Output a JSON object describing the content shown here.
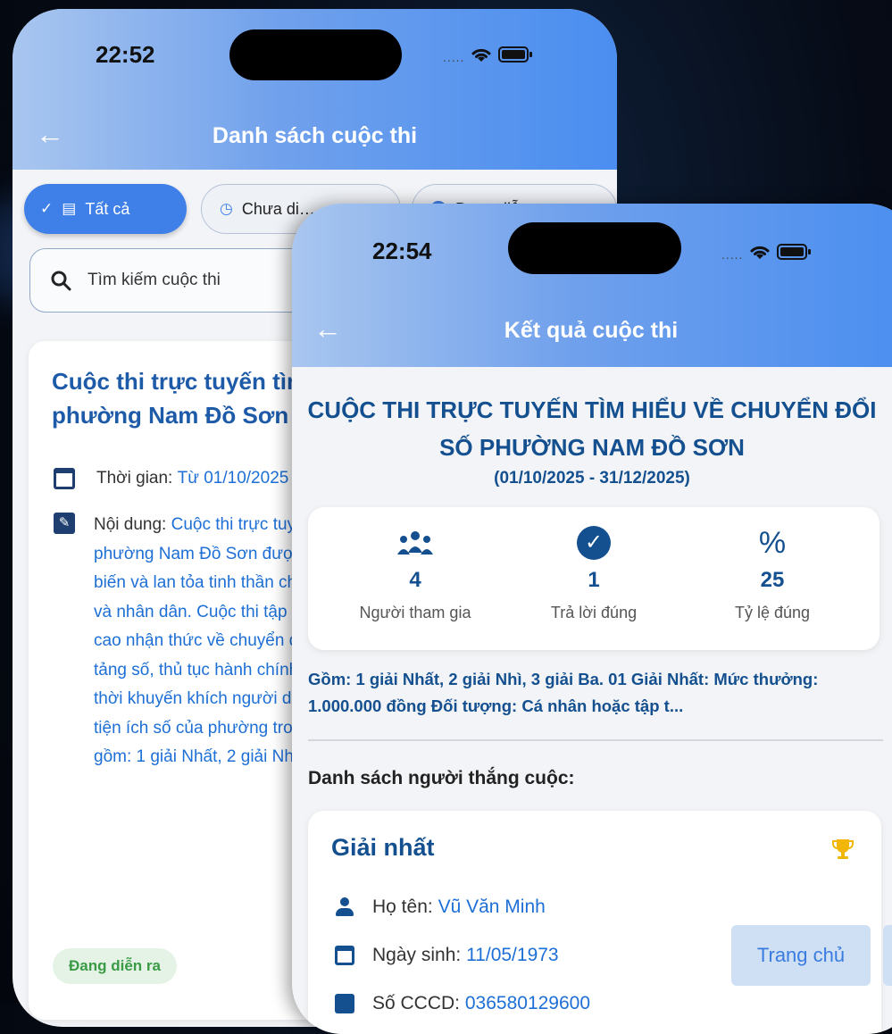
{
  "screen_a": {
    "status": {
      "time": "22:52",
      "dots": "....."
    },
    "header": {
      "title": "Danh sách cuộc thi"
    },
    "filters": [
      {
        "label": "Tất cả",
        "selected": true
      },
      {
        "label": "Chưa di…",
        "selected": false
      },
      {
        "label": "Đang diễ…",
        "selected": false
      }
    ],
    "search": {
      "placeholder": "Tìm kiếm cuộc thi"
    },
    "card": {
      "title": "Cuộc thi trực tuyến tìm hiểu về Chuyển đổi số phường Nam Đồ Sơn",
      "time_label": "Thời gian:",
      "time_value": "Từ 01/10/2025 đến 31/12/2025",
      "content_label": "Nội dung:",
      "content_value": "Cuộc thi trực tuyến tìm hiểu về Chuyển đổi số phường Nam Đồ Sơn được tổ chức nhằm tuyên truyền, phổ biến và lan tỏa tinh thần chuyển đổi số đến cán bộ, đảng viên và nhân dân. Cuộc thi tập trung vào các nội dung như: nâng cao nhận thức về chuyển đổi số, kỹ năng sử dụng các nền tảng số, thủ tục hành chính, dịch vụ công trực tuyến; đồng thời khuyến khích người dân chủ động tiếp cận, sử dụng các tiện ích số của phường trong đời sống thực tiễn. Giải thưởng gồm: 1 giải Nhất, 2 giải Nhì, 3 giải Ba.",
      "status_badge": "Đang diễn ra"
    }
  },
  "screen_b": {
    "status": {
      "time": "22:54",
      "dots": "....."
    },
    "header": {
      "title": "Kết quả cuộc thi"
    },
    "contest_title": "CUỘC THI TRỰC TUYẾN TÌM HIỂU VỀ CHUYỂN ĐỔI SỐ PHƯỜNG NAM ĐỒ SƠN",
    "period": "(01/10/2025 - 31/12/2025)",
    "stats": [
      {
        "icon": "people-icon",
        "value": "4",
        "label": "Người tham gia"
      },
      {
        "icon": "check-circle-icon",
        "value": "1",
        "label": "Trả lời đúng"
      },
      {
        "icon": "percent-icon",
        "value": "25",
        "label": "Tỷ lệ đúng"
      }
    ],
    "description": "Gồm: 1 giải Nhất, 2 giải Nhì, 3 giải Ba. 01 Giải Nhất: Mức thưởng: 1.000.000 đồng Đối tượng: Cá nhân hoặc tập t...",
    "winners_label": "Danh sách người thắng cuộc:",
    "winner": {
      "prize": "Giải nhất",
      "name_label": "Họ tên:",
      "name": "Vũ Văn Minh",
      "dob_label": "Ngày sinh:",
      "dob": "11/05/1973",
      "id_label": "Số CCCD:",
      "id": "036580129600"
    },
    "home_button": "Trang chủ"
  },
  "colors": {
    "accent": "#3f7fe8",
    "title_blue": "#14508f",
    "link_blue": "#1d6fd6",
    "badge_green": "#3a9a45"
  }
}
